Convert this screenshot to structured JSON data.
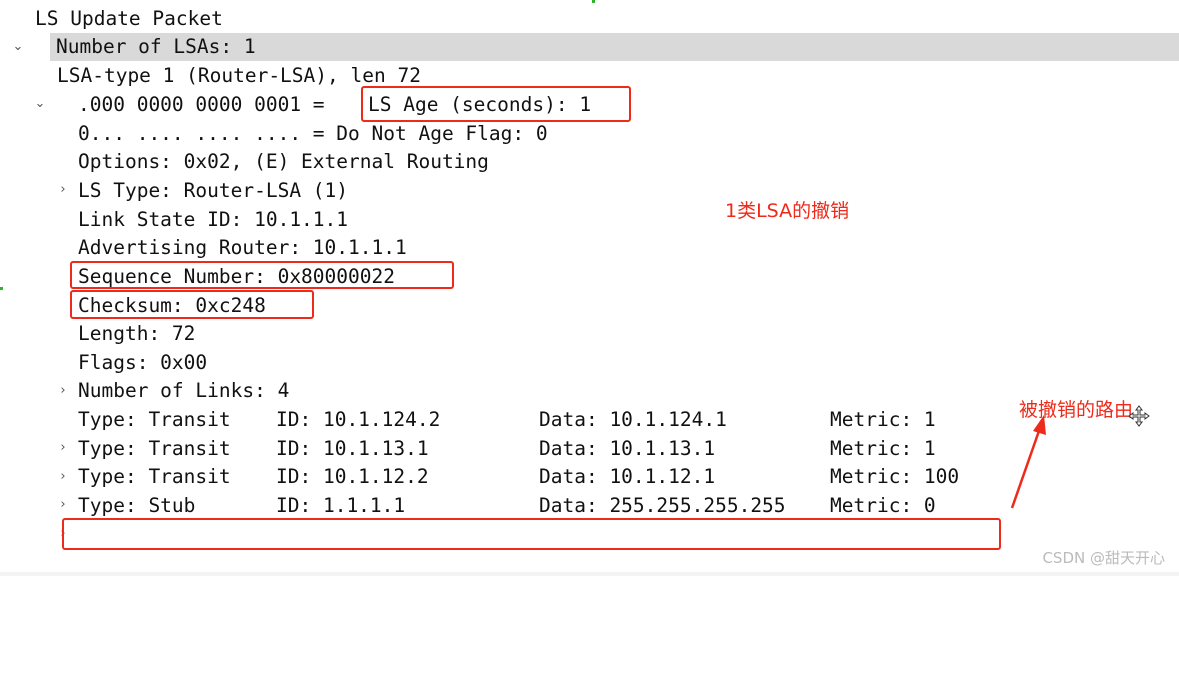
{
  "tree": {
    "header": {
      "label": "LS Update Packet"
    },
    "num_lsas": {
      "label": "Number of LSAs: 1"
    },
    "lsa": {
      "label": "LSA-type 1 (Router-LSA), len 72"
    },
    "fields": {
      "ls_age_bits": ".000 0000 0000 0001 = ",
      "ls_age_text": "LS Age (seconds): 1",
      "dna_flag": "0... .... .... .... = Do Not Age Flag: 0",
      "options": "Options: 0x02, (E) External Routing",
      "ls_type": "LS Type: Router-LSA (1)",
      "link_state_id": "Link State ID: 10.1.1.1",
      "adv_router": "Advertising Router: 10.1.1.1",
      "seq_number": "Sequence Number: 0x80000022",
      "checksum": "Checksum: 0xc248",
      "length": "Length: 72",
      "flags": "Flags: 0x00",
      "num_links": "Number of Links: 4"
    },
    "links": [
      {
        "type": "Type: Transit",
        "id": "ID: 10.1.124.2",
        "data": "Data: 10.1.124.1",
        "metric": "Metric: 1"
      },
      {
        "type": "Type: Transit",
        "id": "ID: 10.1.13.1",
        "data": "Data: 10.1.13.1",
        "metric": "Metric: 1"
      },
      {
        "type": "Type: Transit",
        "id": "ID: 10.1.12.2",
        "data": "Data: 10.1.12.1",
        "metric": "Metric: 100"
      },
      {
        "type": "Type: Stub",
        "id": "ID: 1.1.1.1",
        "data": "Data: 255.255.255.255",
        "metric": "Metric: 0"
      }
    ]
  },
  "annotations": {
    "lsa_withdraw": "1类LSA的撤销",
    "withdrawn_route": "被撤销的路由"
  },
  "watermark": "CSDN @甜天开心",
  "colors": {
    "annotation_red": "#ee2a1a",
    "selected_row": "#d9d9d9",
    "text": "#111111"
  }
}
